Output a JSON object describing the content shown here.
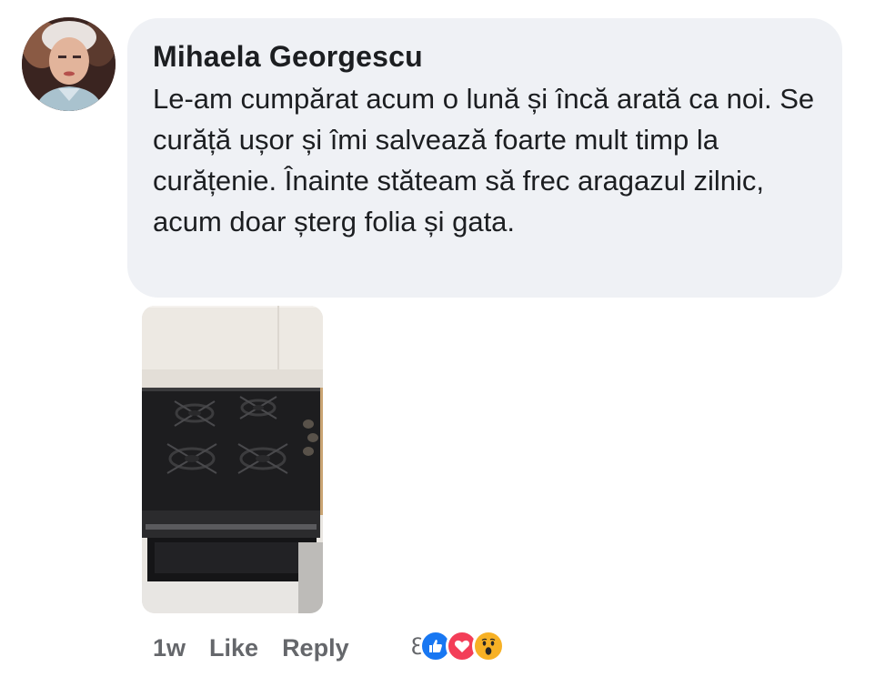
{
  "comment": {
    "author": "Mihaela Georgescu",
    "text": "Le-am cumpărat acum o lună și încă arată ca noi. Se curăță ușor și îmi salvează foarte mult timp la curățenie. Înainte stăteam să frec aragazul zilnic, acum doar șterg folia și gata.",
    "timestamp": "1w",
    "like_label": "Like",
    "reply_label": "Reply",
    "reaction_count": "8",
    "reactions": [
      "like-icon",
      "love-icon",
      "wow-icon"
    ]
  },
  "colors": {
    "bubble_bg": "#eff1f5",
    "text": "#1c1e21",
    "meta_text": "#65676b",
    "like_blue": "#1877f2",
    "love_red": "#f33e58",
    "wow_yellow": "#f7b125"
  }
}
